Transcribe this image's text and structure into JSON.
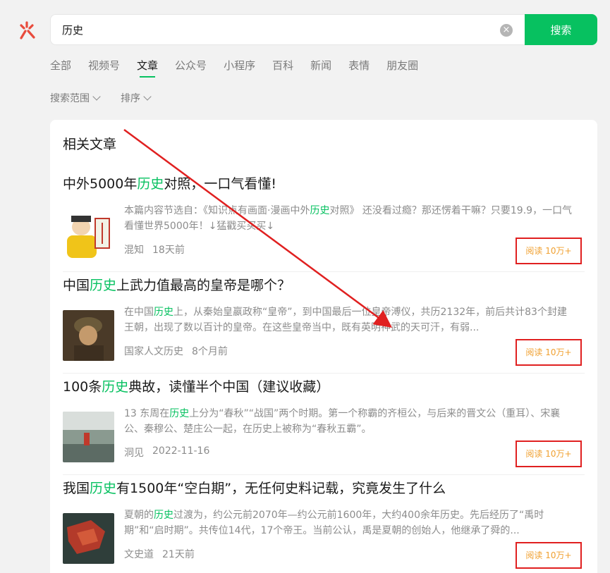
{
  "search": {
    "query": "历史",
    "button_label": "搜索",
    "clear_icon": "clear-icon"
  },
  "tabs": [
    "全部",
    "视频号",
    "文章",
    "公众号",
    "小程序",
    "百科",
    "新闻",
    "表情",
    "朋友圈"
  ],
  "active_tab": "文章",
  "filters": {
    "range": "搜索范围",
    "sort": "排序"
  },
  "section": {
    "title": "相关文章"
  },
  "articles": [
    {
      "title_pre": "中外5000年",
      "title_hl": "历史",
      "title_post": "对照，一口气看懂!",
      "excerpt_pre": "本篇内容节选自：《知识点有画面·漫画中外",
      "excerpt_hl": "历史",
      "excerpt_post": "对照》 还没看过瘾？那还愣着干嘛？只要19.9，一口气看懂世界5000年！↓猛戳买买买↓",
      "source": "混知",
      "time": "18天前",
      "read": "阅读 10万+"
    },
    {
      "title_pre": "中国",
      "title_hl": "历史",
      "title_post": "上武力值最高的皇帝是哪个？",
      "excerpt_pre": "在中国",
      "excerpt_hl": "历史",
      "excerpt_post": "上，从秦始皇嬴政称“皇帝”，到中国最后一位皇帝溥仪，共历2132年，前后共计83个封建王朝，出现了数以百计的皇帝。在这些皇帝当中，既有英明神武的天可汗，有弱...",
      "source": "国家人文历史",
      "time": "8个月前",
      "read": "阅读 10万+"
    },
    {
      "title_pre": "100条",
      "title_hl": "历史",
      "title_post": "典故，读懂半个中国（建议收藏）",
      "excerpt_pre": "13 东周在",
      "excerpt_hl": "历史",
      "excerpt_post": "上分为“春秋”“战国”两个时期。第一个称霸的齐桓公，与后来的晋文公（重耳）、宋襄公、秦穆公、楚庄公一起，在历史上被称为“春秋五霸”。",
      "source": "洞见",
      "time": "2022-11-16",
      "read": "阅读 10万+"
    },
    {
      "title_pre": "我国",
      "title_hl": "历史",
      "title_post": "有1500年“空白期”，无任何史料记载，究竟发生了什么",
      "excerpt_pre": "夏朝的",
      "excerpt_hl": "历史",
      "excerpt_post": "过渡为，约公元前2070年—约公元前1600年，大约400余年历史。先后经历了“禹时期”和“启时期”。共传位14代，17个帝王。当前公认，禹是夏朝的创始人，他继承了舜的...",
      "source": "文史道",
      "time": "21天前",
      "read": "阅读 10万+"
    }
  ],
  "colors": {
    "accent": "#07c160",
    "highlight_box": "#e02020",
    "read_text": "#f0a030",
    "annotation_arrow": "#e02020"
  }
}
